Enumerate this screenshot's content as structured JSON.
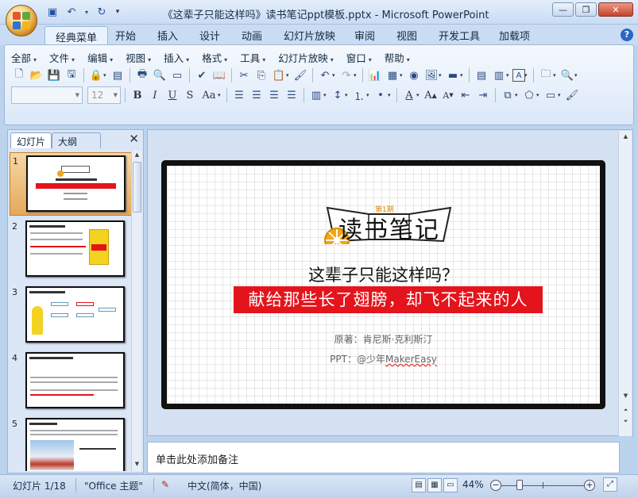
{
  "window": {
    "title": "《这辈子只能这样吗》读书笔记ppt模板.pptx - Microsoft PowerPoint",
    "minimize": "—",
    "restore": "❐",
    "close": "✕"
  },
  "qat": [
    "save-icon",
    "undo-icon",
    "redo-icon"
  ],
  "ribbon_tabs": [
    "经典菜单",
    "开始",
    "插入",
    "设计",
    "动画",
    "幻灯片放映",
    "审阅",
    "视图",
    "开发工具",
    "加载项"
  ],
  "menus": [
    "全部",
    "文件",
    "编辑",
    "视图",
    "插入",
    "格式",
    "工具",
    "幻灯片放映",
    "窗口",
    "帮助"
  ],
  "font_size": "12",
  "panel": {
    "tab_slides": "幻灯片",
    "tab_outline": "大纲",
    "slide_numbers": [
      "1",
      "2",
      "3",
      "4",
      "5"
    ]
  },
  "slide": {
    "banner_badge": "第1期",
    "banner_text": "读书笔记",
    "title": "这辈子只能这样吗？",
    "subtitle": "献给那些长了翅膀，却飞不起来的人",
    "author": "原著：肯尼斯·克利斯汀",
    "ppt_prefix": "PPT：@少年",
    "ppt_brand": "MakerEasy"
  },
  "notes_placeholder": "单击此处添加备注",
  "status": {
    "slide_info": "幻灯片 1/18",
    "theme": "\"Office 主题\"",
    "language": "中文(简体，中国)",
    "zoom": "44%"
  },
  "colors": {
    "accent_red": "#e4141c",
    "ribbon_blue": "#c9dcf4",
    "selection": "#e6a85b"
  }
}
